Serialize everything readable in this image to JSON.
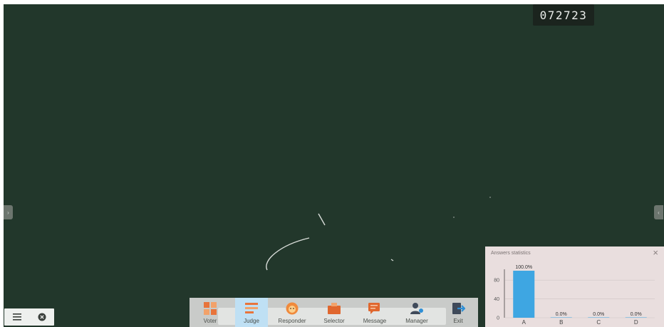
{
  "session_code": "072723",
  "side_tabs": {
    "left_glyph": "›",
    "right_glyph": "‹"
  },
  "bottom_left": {
    "menu_icon": "menu-icon",
    "close_icon": "close-circle-icon"
  },
  "toolbar": {
    "tools": [
      {
        "id": "voter",
        "label": "Voter",
        "icon": "voter-icon",
        "color": "#e8743b",
        "active": false
      },
      {
        "id": "judge",
        "label": "Judge",
        "icon": "judge-icon",
        "color": "#e8743b",
        "active": true
      },
      {
        "id": "responder",
        "label": "Responder",
        "icon": "responder-icon",
        "color": "#f08a3c",
        "active": false
      },
      {
        "id": "selector",
        "label": "Selector",
        "icon": "selector-icon",
        "color": "#e0672e",
        "active": false
      },
      {
        "id": "message",
        "label": "Message",
        "icon": "message-icon",
        "color": "#e0672e",
        "active": false
      },
      {
        "id": "manager",
        "label": "Manager",
        "icon": "manager-icon",
        "color": "#3f4a5a",
        "active": false
      },
      {
        "id": "exit",
        "label": "Exit",
        "icon": "exit-icon",
        "color": "#2e8fd6",
        "active": false
      }
    ]
  },
  "answers_statistics": {
    "title": "Answers statistics",
    "close_icon": "close-icon"
  },
  "chart_data": {
    "type": "bar",
    "categories": [
      "A",
      "B",
      "C",
      "D"
    ],
    "values": [
      100.0,
      0.0,
      0.0,
      0.0
    ],
    "value_labels": [
      "100.0%",
      "0.0%",
      "0.0%",
      "0.0%"
    ],
    "yticks": [
      0,
      40,
      80
    ],
    "ylim": [
      0,
      100
    ],
    "bar_color": "#3ea6e2",
    "grid": true
  },
  "colors": {
    "board": "#22372b",
    "chalk": "#d9ddd9",
    "toolbar": "#c9cbc9",
    "stats_panel": "#e9dede"
  }
}
